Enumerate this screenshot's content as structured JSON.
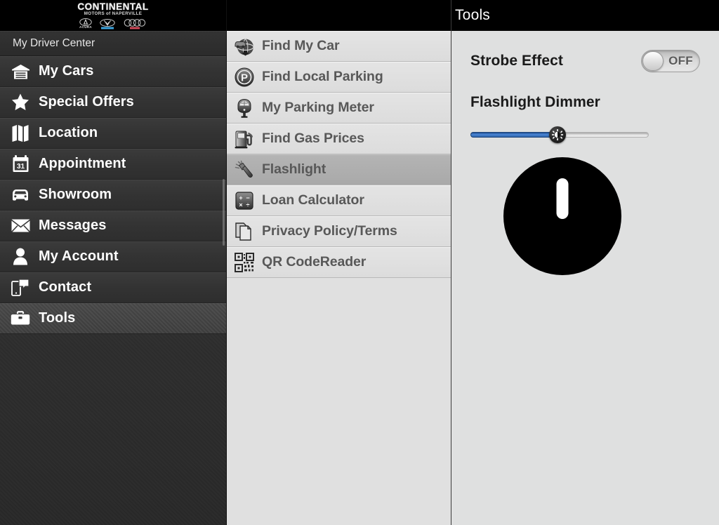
{
  "brand": {
    "logo_wordmark": "CONTINENTAL",
    "logo_subtitle": "MOTORS of NAPERVILLE",
    "brands": [
      {
        "name": "ACURA",
        "icon": "acura-logo",
        "color": "#e0e0e0"
      },
      {
        "name": "Volkswagen",
        "icon": "volkswagen-logo",
        "color": "#3da5e0"
      },
      {
        "name": "Audi",
        "icon": "audi-logo",
        "color": "#d44a5a"
      }
    ]
  },
  "sidebar": {
    "header": "My Driver Center",
    "items": [
      {
        "label": "My Cars",
        "icon": "garage-icon",
        "active": false
      },
      {
        "label": "Special Offers",
        "icon": "star-icon",
        "active": false
      },
      {
        "label": "Location",
        "icon": "map-icon",
        "active": false
      },
      {
        "label": "Appointment",
        "icon": "calendar-icon",
        "active": false
      },
      {
        "label": "Showroom",
        "icon": "car-front-icon",
        "active": false
      },
      {
        "label": "Messages",
        "icon": "envelope-icon",
        "active": false
      },
      {
        "label": "My Account",
        "icon": "person-icon",
        "active": false
      },
      {
        "label": "Contact",
        "icon": "phone-chat-icon",
        "active": false
      },
      {
        "label": "Tools",
        "icon": "toolbox-icon",
        "active": true
      }
    ]
  },
  "tools_list": {
    "items": [
      {
        "label": "Find My Car",
        "icon": "car-globe-icon",
        "selected": false
      },
      {
        "label": "Find Local Parking",
        "icon": "parking-p-icon",
        "selected": false
      },
      {
        "label": "My Parking Meter",
        "icon": "parking-meter-icon",
        "selected": false
      },
      {
        "label": "Find Gas Prices",
        "icon": "gas-pump-icon",
        "selected": false
      },
      {
        "label": "Flashlight",
        "icon": "flashlight-icon",
        "selected": true
      },
      {
        "label": "Loan Calculator",
        "icon": "calculator-icon",
        "selected": false
      },
      {
        "label": "Privacy Policy/Terms",
        "icon": "documents-icon",
        "selected": false
      },
      {
        "label": "QR CodeReader",
        "icon": "qr-code-icon",
        "selected": false
      }
    ]
  },
  "detail": {
    "title": "Tools",
    "strobe_label": "Strobe Effect",
    "strobe_state": "OFF",
    "dimmer_label": "Flashlight Dimmer",
    "dimmer_value_percent": 49,
    "flashlight_button": "flashlight-power-button"
  },
  "colors": {
    "header_bg": "#000000",
    "sidebar_bg": "#333333",
    "list_bg": "#e0e0e0",
    "list_selected_bg": "#aeaeae",
    "detail_bg": "#dfe0e0",
    "slider_fill": "#3a70bd",
    "label_text": "#585858"
  }
}
